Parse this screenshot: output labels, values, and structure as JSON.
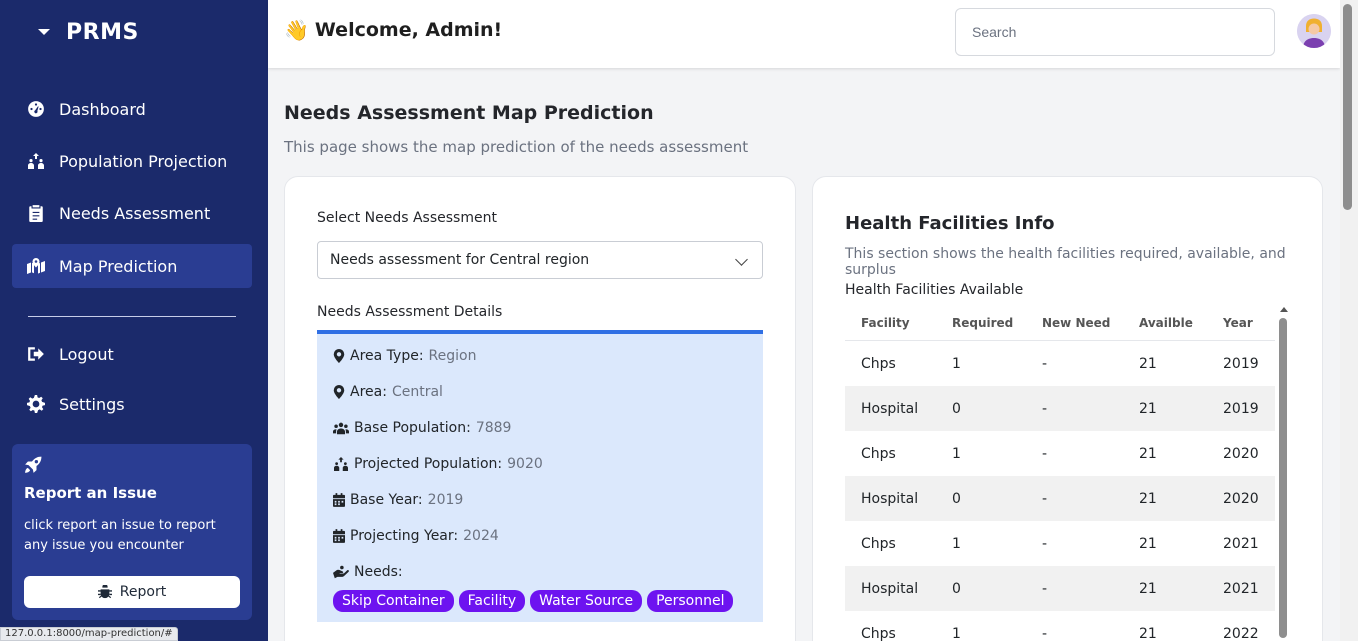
{
  "brand": {
    "name": "PRMS"
  },
  "sidebar": {
    "items": [
      {
        "label": "Dashboard",
        "icon": "dashboard-gauge-icon"
      },
      {
        "label": "Population Projection",
        "icon": "people-arrows-icon"
      },
      {
        "label": "Needs Assessment",
        "icon": "clipboard-icon"
      },
      {
        "label": "Map Prediction",
        "icon": "map-location-icon",
        "active": true
      }
    ],
    "bottom_items": [
      {
        "label": "Logout",
        "icon": "sign-out-icon"
      },
      {
        "label": "Settings",
        "icon": "gear-icon"
      }
    ],
    "report": {
      "title": "Report an Issue",
      "text": "click report an issue to report any issue you encounter",
      "button": "Report"
    }
  },
  "status_url": "127.0.0.1:8000/map-prediction/#",
  "header": {
    "welcome": "Welcome, Admin!",
    "wave_emoji": "👋",
    "search_placeholder": "Search"
  },
  "page": {
    "title": "Needs Assessment Map Prediction",
    "subtitle": "This page shows the map prediction of the needs assessment"
  },
  "left_card": {
    "select_label": "Select Needs Assessment",
    "select_value": "Needs assessment for Central region",
    "details_label": "Needs Assessment Details",
    "details": {
      "area_type": {
        "label": "Area Type:",
        "value": "Region"
      },
      "area": {
        "label": "Area:",
        "value": "Central"
      },
      "base_population": {
        "label": "Base Population:",
        "value": "7889"
      },
      "projected_population": {
        "label": "Projected Population:",
        "value": "9020"
      },
      "base_year": {
        "label": "Base Year:",
        "value": "2019"
      },
      "projecting_year": {
        "label": "Projecting Year:",
        "value": "2024"
      },
      "needs": {
        "label": "Needs:"
      }
    },
    "tags": [
      "Skip Container",
      "Facility",
      "Water Source",
      "Personnel"
    ],
    "tag_color": "#6d13f0"
  },
  "right_card": {
    "title": "Health Facilities Info",
    "subtitle": "This section shows the health facilities required, available, and surplus",
    "table_label": "Health Facilities Available",
    "columns": [
      "Facility",
      "Required",
      "New Need",
      "Availble",
      "Year"
    ],
    "rows": [
      [
        "Chps",
        "1",
        "-",
        "21",
        "2019"
      ],
      [
        "Hospital",
        "0",
        "-",
        "21",
        "2019"
      ],
      [
        "Chps",
        "1",
        "-",
        "21",
        "2020"
      ],
      [
        "Hospital",
        "0",
        "-",
        "21",
        "2020"
      ],
      [
        "Chps",
        "1",
        "-",
        "21",
        "2021"
      ],
      [
        "Hospital",
        "0",
        "-",
        "21",
        "2021"
      ],
      [
        "Chps",
        "1",
        "-",
        "21",
        "2022"
      ]
    ]
  },
  "colors": {
    "sidebar": "#1b2a6b",
    "active": "#2a3d92",
    "accent": "#2f6fe4"
  }
}
